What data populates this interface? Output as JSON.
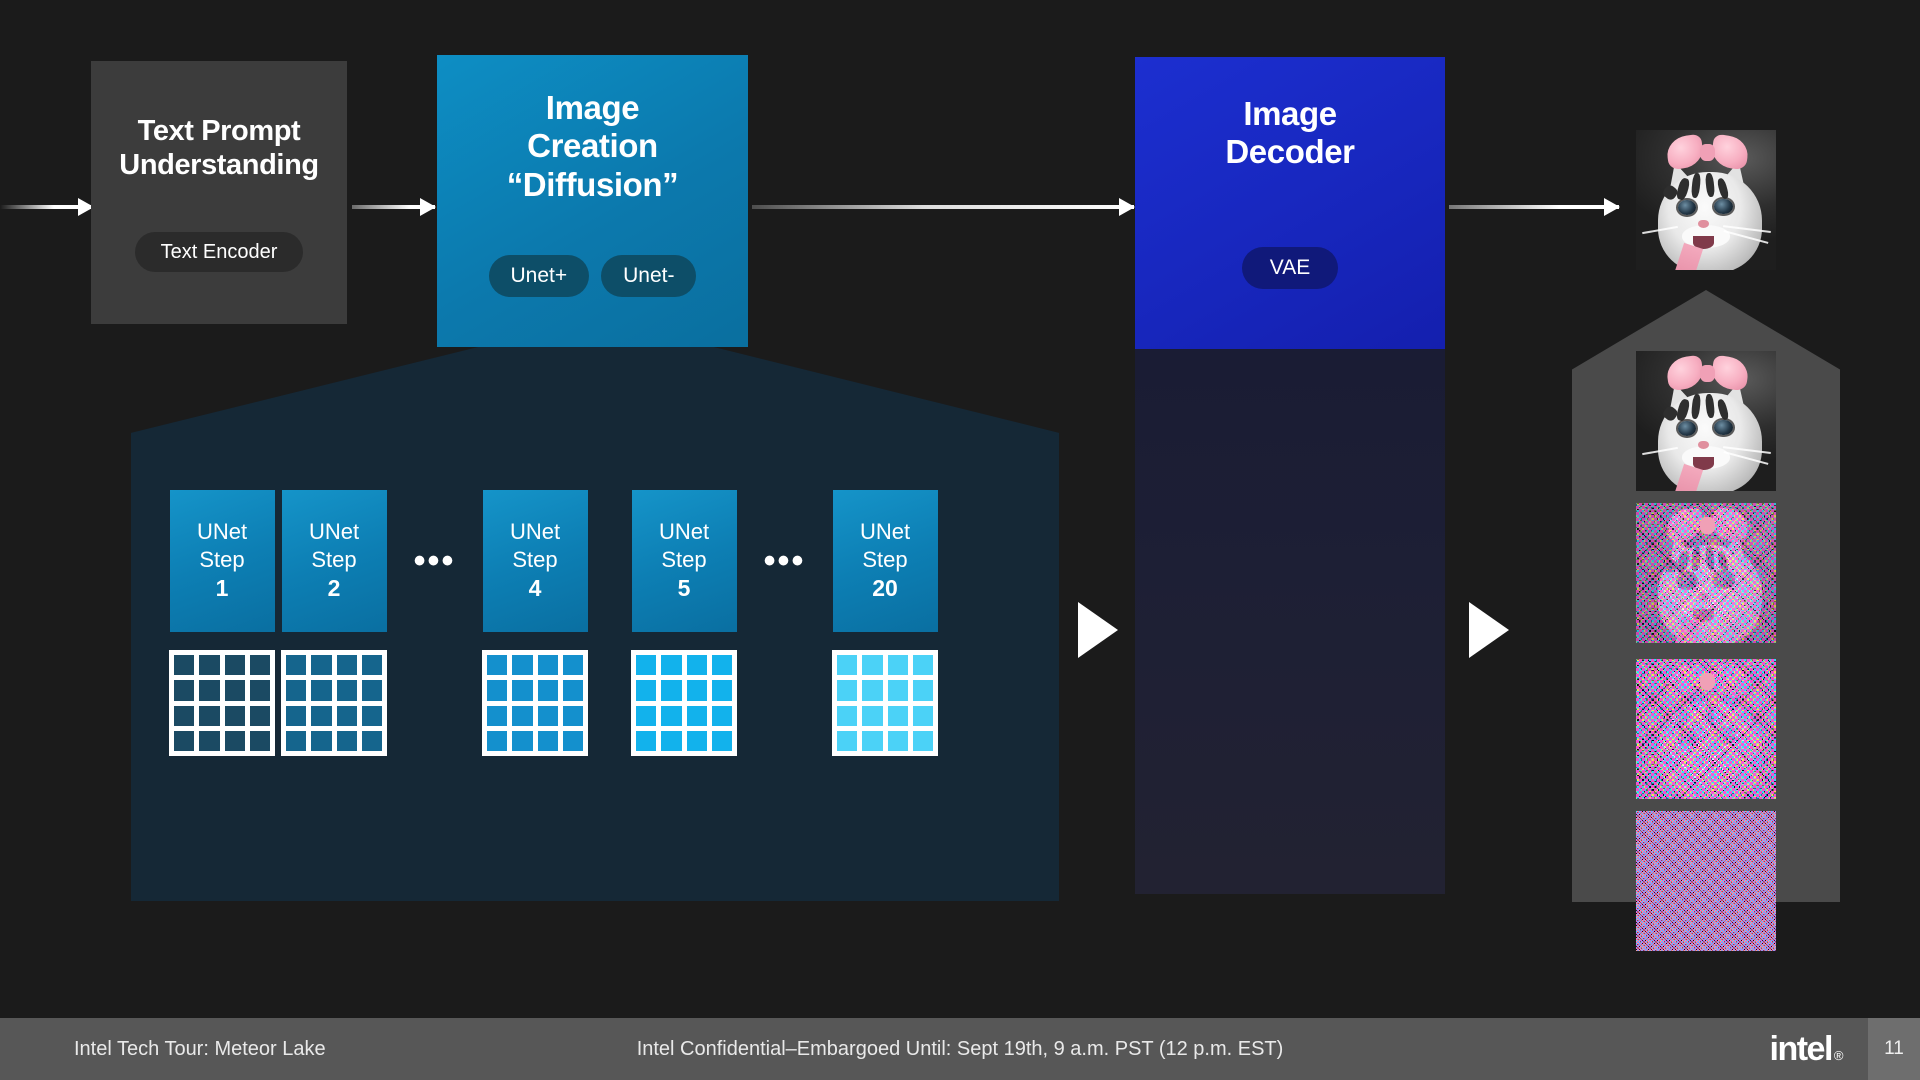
{
  "slide": {
    "background_color": "#1b1b1b",
    "page_number": "11"
  },
  "pipeline": {
    "stages": [
      {
        "id": "text-prompt-understanding",
        "title": "Text Prompt\nUnderstanding",
        "title_line1": "Text Prompt",
        "title_line2": "Understanding",
        "color": "#3c3c3c",
        "pills": [
          "Text Encoder"
        ]
      },
      {
        "id": "image-creation-diffusion",
        "title_line1": "Image",
        "title_line2": "Creation",
        "title_line3": "“Diffusion”",
        "color": "#0c7cb1",
        "pills": [
          "Unet+",
          "Unet-"
        ]
      },
      {
        "id": "image-decoder",
        "title_line1": "Image",
        "title_line2": "Decoder",
        "color": "#1726bc",
        "pills": [
          "VAE"
        ]
      }
    ]
  },
  "diffusion_detail": {
    "panel_color": "#152836",
    "steps": [
      {
        "label_line1": "UNet",
        "label_line2": "Step",
        "number": "1",
        "tile_color": "#1b4a63"
      },
      {
        "label_line1": "UNet",
        "label_line2": "Step",
        "number": "2",
        "tile_color": "#15658d"
      },
      {
        "label_line1": "UNet",
        "label_line2": "Step",
        "number": "4",
        "tile_color": "#1490cd"
      },
      {
        "label_line1": "UNet",
        "label_line2": "Step",
        "number": "5",
        "tile_color": "#12b2ec"
      },
      {
        "label_line1": "UNet",
        "label_line2": "Step",
        "number": "20",
        "tile_color": "#4bd2f7"
      }
    ],
    "separator": "•••",
    "separator_after_indices": [
      2,
      4
    ]
  },
  "output_images": {
    "final": {
      "caption": "kitten-with-pink-bow",
      "noise_level": 0
    },
    "stack": [
      {
        "caption": "kitten-with-pink-bow-clean",
        "noise_level": 0
      },
      {
        "caption": "kitten-with-pink-bow-light-noise",
        "noise_level": 2
      },
      {
        "caption": "kitten-with-pink-bow-heavy-noise",
        "noise_level": 3
      },
      {
        "caption": "pure-random-noise",
        "noise_level": 4
      }
    ]
  },
  "footer": {
    "left": "Intel Tech Tour: Meteor Lake",
    "center": "Intel Confidential–Embargoed Until: Sept 19th, 9 a.m. PST (12 p.m. EST)",
    "logo": "intel",
    "logo_mark": "®",
    "page": "11",
    "bar_color": "#575757",
    "page_box_color": "#6e6e6e"
  }
}
